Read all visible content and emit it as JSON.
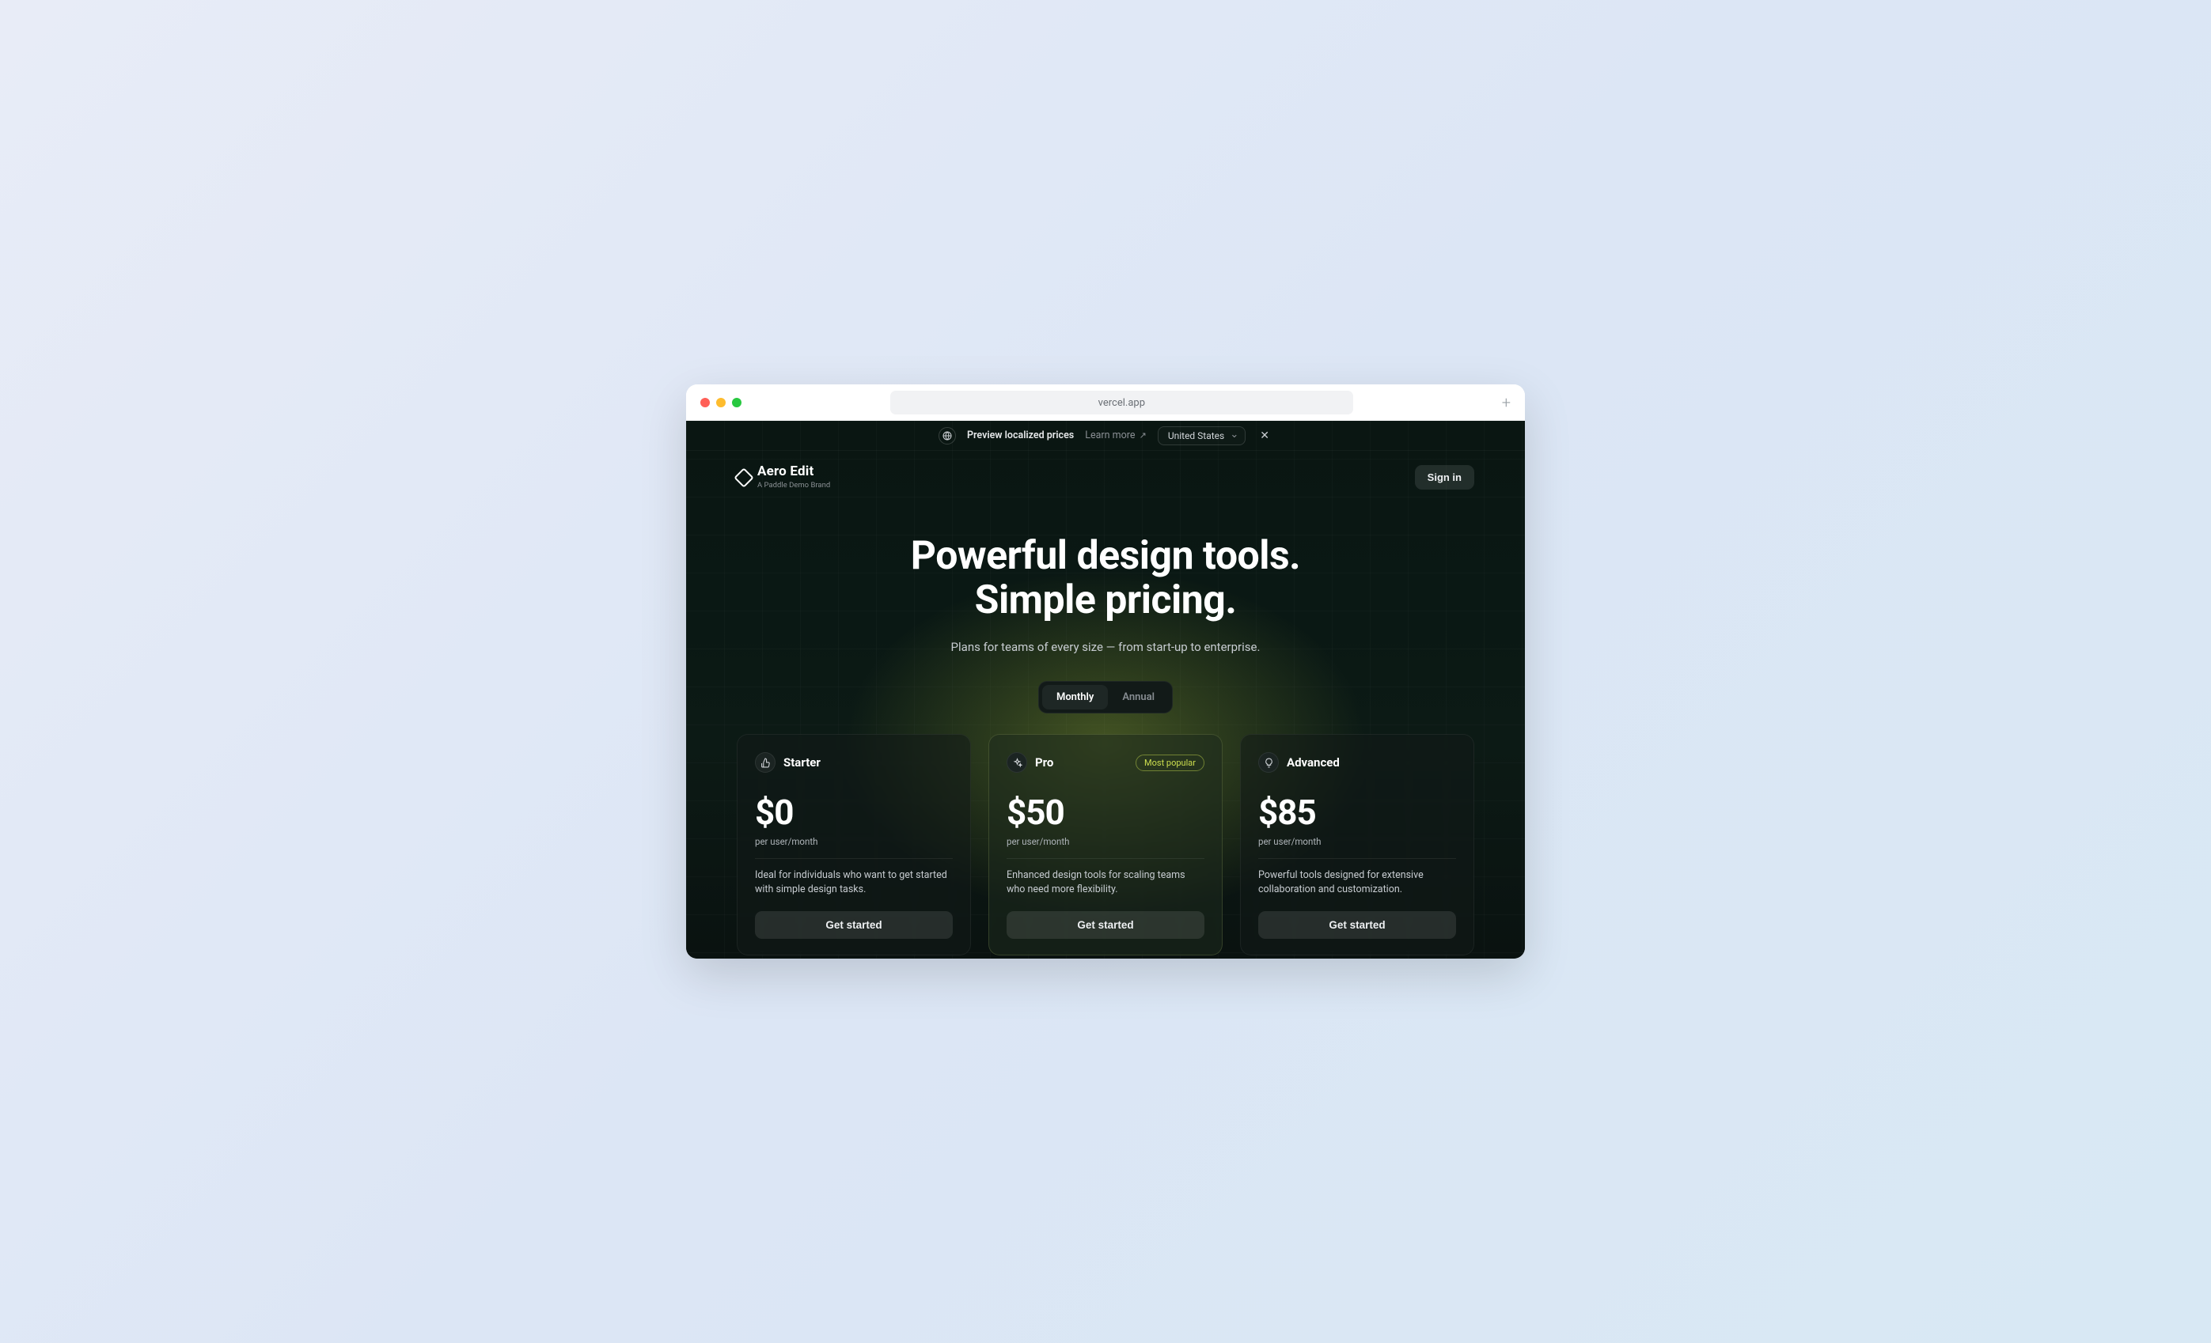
{
  "browser": {
    "url": "vercel.app"
  },
  "banner": {
    "message": "Preview localized prices",
    "learn_more": "Learn more",
    "country": "United States"
  },
  "brand": {
    "name": "Aero Edit",
    "subtitle": "A Paddle Demo Brand"
  },
  "nav": {
    "signin": "Sign in"
  },
  "hero": {
    "line1": "Powerful design tools.",
    "line2": "Simple pricing.",
    "subtitle": "Plans for teams of every size — from start-up to enterprise."
  },
  "toggle": {
    "monthly": "Monthly",
    "annual": "Annual"
  },
  "plans": [
    {
      "name": "Starter",
      "price": "$0",
      "unit": "per user/month",
      "desc": "Ideal for individuals who want to get started with simple design tasks.",
      "cta": "Get started",
      "badge": ""
    },
    {
      "name": "Pro",
      "price": "$50",
      "unit": "per user/month",
      "desc": "Enhanced design tools for scaling teams who need more flexibility.",
      "cta": "Get started",
      "badge": "Most popular"
    },
    {
      "name": "Advanced",
      "price": "$85",
      "unit": "per user/month",
      "desc": "Powerful tools designed for extensive collaboration and customization.",
      "cta": "Get started",
      "badge": ""
    }
  ]
}
